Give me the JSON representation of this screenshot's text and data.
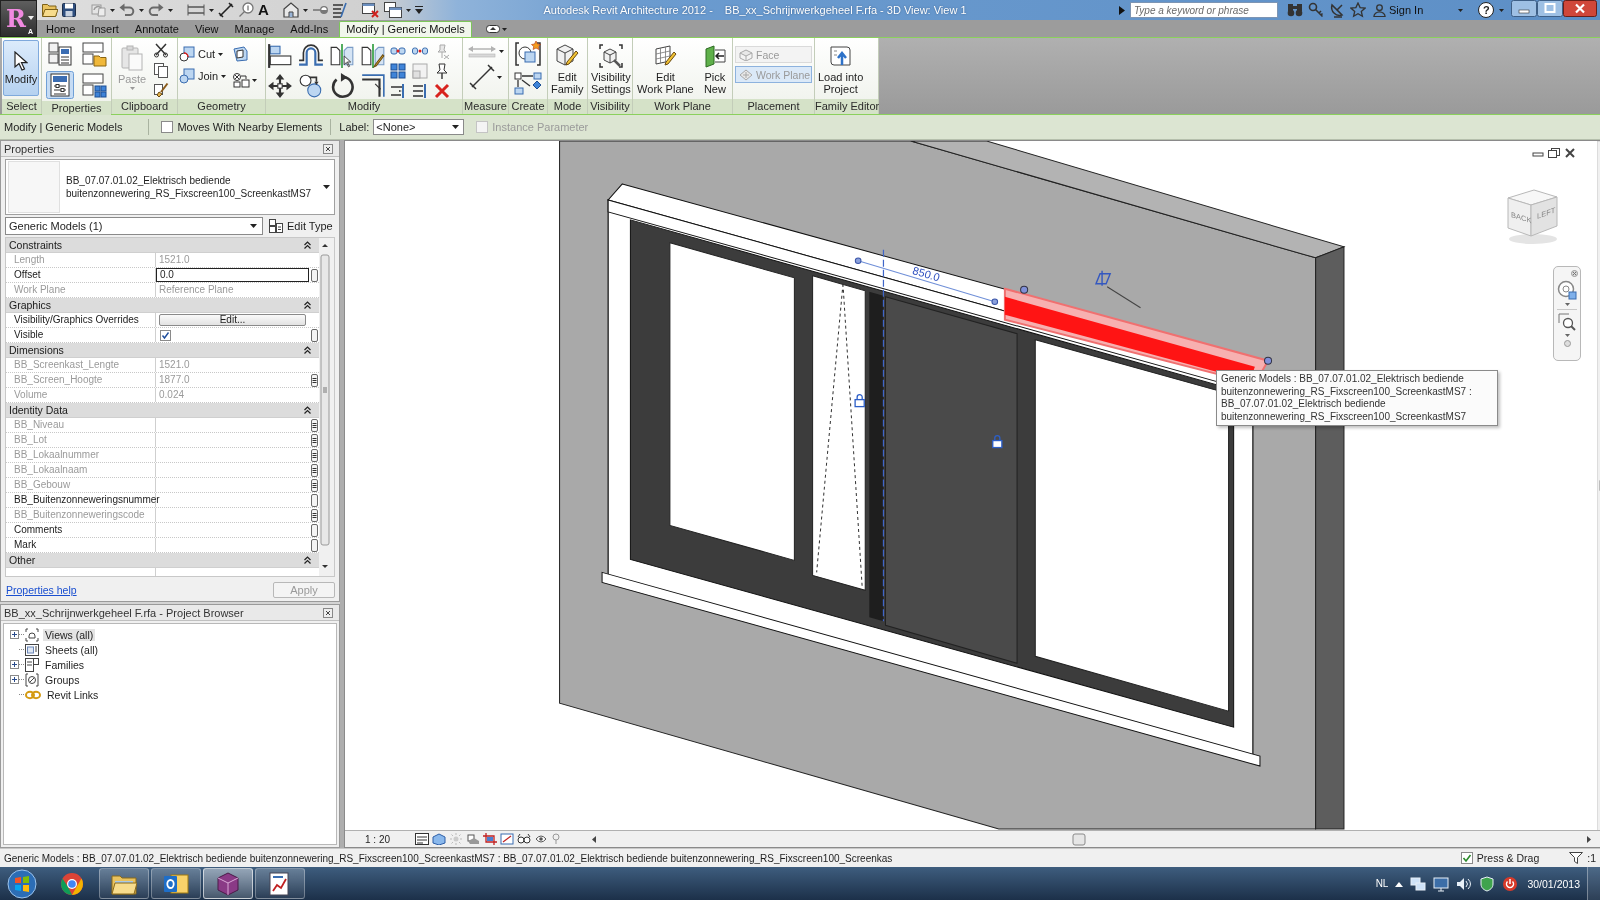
{
  "app_button": {
    "logo": "R",
    "edition": "A"
  },
  "quick_access": {
    "text_tool": "A"
  },
  "title_bar": {
    "app_title": "Autodesk Revit Architecture 2012 -",
    "document_title": "BB_xx_Schrijnwerkgeheel F.rfa - 3D View: View 1",
    "search": {
      "placeholder": "Type a keyword or phrase"
    },
    "sign_in": "Sign In",
    "help": "?"
  },
  "ribbon": {
    "tabs": [
      {
        "label": "Home",
        "selected": false
      },
      {
        "label": "Insert",
        "selected": false
      },
      {
        "label": "Annotate",
        "selected": false
      },
      {
        "label": "View",
        "selected": false
      },
      {
        "label": "Manage",
        "selected": false
      },
      {
        "label": "Add-Ins",
        "selected": false
      },
      {
        "label": "Modify | Generic Models",
        "selected": true
      }
    ],
    "panels": [
      {
        "label": "Select",
        "buttons": [
          {
            "label": "Modify",
            "selected": true,
            "disabled": false
          }
        ]
      },
      {
        "label": "Properties",
        "toggles": [
          {
            "selected": false
          },
          {
            "selected": false
          },
          {
            "selected": true
          },
          {
            "selected": false
          }
        ]
      },
      {
        "label": "Clipboard",
        "buttons": [
          {
            "label": "Paste",
            "disabled": true
          }
        ]
      },
      {
        "label": "Geometry",
        "buttons": [
          {
            "label": "Cut",
            "disabled": false
          },
          {
            "label": "Join",
            "disabled": false
          }
        ]
      },
      {
        "label": "Modify"
      },
      {
        "label": "Measure"
      },
      {
        "label": "Create"
      },
      {
        "label": "Mode",
        "buttons": [
          {
            "label": "Edit\nFamily",
            "disabled": false
          }
        ]
      },
      {
        "label": "Visibility",
        "buttons": [
          {
            "label": "Visibility\nSettings",
            "disabled": false
          }
        ]
      },
      {
        "label": "Work Plane",
        "buttons": [
          {
            "label": "Edit\nWork Plane",
            "disabled": false
          },
          {
            "label": "Pick\nNew",
            "disabled": false
          }
        ]
      },
      {
        "label": "Placement",
        "buttons": [
          {
            "label": "Face",
            "disabled": true,
            "selected": false
          },
          {
            "label": "Work Plane",
            "disabled": true,
            "selected": true
          }
        ]
      },
      {
        "label": "Family Editor",
        "buttons": [
          {
            "label": "Load into\nProject",
            "disabled": false
          }
        ]
      }
    ]
  },
  "options_bar": {
    "context": "Modify | Generic Models",
    "moves_with_nearby": {
      "label": "Moves With Nearby Elements",
      "checked": false
    },
    "label_field": {
      "label": "Label:",
      "value": "<None>"
    },
    "instance_parameter": {
      "label": "Instance Parameter",
      "checked": false,
      "disabled": true
    }
  },
  "properties": {
    "title": "Properties",
    "type_name": "BB_07.07.01.02_Elektrisch bediende buitenzonnewering_RS_Fixscreen100_ScreenkastMS7",
    "selector": "Generic Models (1)",
    "edit_type": "Edit Type",
    "groups": [
      {
        "name": "Constraints",
        "expanded": true,
        "rows": [
          {
            "name": "Length",
            "kind": "text",
            "value": "1521.0",
            "disabled": true
          },
          {
            "name": "Offset",
            "kind": "input",
            "value": "0.0",
            "disabled": false,
            "associated": false
          },
          {
            "name": "Work Plane",
            "kind": "text",
            "value": "Reference Plane",
            "disabled": true
          }
        ]
      },
      {
        "name": "Graphics",
        "expanded": true,
        "rows": [
          {
            "name": "Visibility/Graphics Overrides",
            "kind": "button",
            "value": "Edit...",
            "disabled": false
          },
          {
            "name": "Visible",
            "kind": "checkbox",
            "checked": true,
            "disabled": false,
            "associated": false
          }
        ]
      },
      {
        "name": "Dimensions",
        "expanded": true,
        "rows": [
          {
            "name": "BB_Screenkast_Lengte",
            "kind": "text",
            "value": "1521.0",
            "disabled": true
          },
          {
            "name": "BB_Screen_Hoogte",
            "kind": "text",
            "value": "1877.0",
            "disabled": true,
            "associated": true
          },
          {
            "name": "Volume",
            "kind": "text",
            "value": "0.024",
            "disabled": true
          }
        ]
      },
      {
        "name": "Identity Data",
        "expanded": true,
        "rows": [
          {
            "name": "BB_Niveau",
            "kind": "text",
            "disabled": true,
            "associated": true
          },
          {
            "name": "BB_Lot",
            "kind": "text",
            "disabled": true,
            "associated": true
          },
          {
            "name": "BB_Lokaalnummer",
            "kind": "text",
            "disabled": true,
            "associated": true
          },
          {
            "name": "BB_Lokaalnaam",
            "kind": "text",
            "disabled": true,
            "associated": true
          },
          {
            "name": "BB_Gebouw",
            "kind": "text",
            "disabled": true,
            "associated": true
          },
          {
            "name": "BB_Buitenzonneweringsnummer",
            "kind": "text",
            "disabled": false,
            "associated": false
          },
          {
            "name": "BB_Buitenzonneweringscode",
            "kind": "text",
            "disabled": true,
            "associated": true
          },
          {
            "name": "Comments",
            "kind": "text",
            "disabled": false,
            "associated": false
          },
          {
            "name": "Mark",
            "kind": "text",
            "disabled": false,
            "associated": false
          }
        ]
      },
      {
        "name": "Other",
        "expanded": true
      }
    ],
    "help_link": "Properties help",
    "apply": {
      "label": "Apply",
      "disabled": true
    }
  },
  "project_browser": {
    "title": "BB_xx_Schrijnwerkgeheel F.rfa - Project Browser",
    "items": [
      {
        "label": "Views (all)",
        "expanded": false,
        "selected": true
      },
      {
        "label": "Sheets (all)",
        "selected": false
      },
      {
        "label": "Families",
        "expanded": false,
        "selected": false
      },
      {
        "label": "Groups",
        "expanded": false,
        "selected": false
      },
      {
        "label": "Revit Links",
        "selected": false
      }
    ]
  },
  "view": {
    "scale": "1 : 20",
    "dimension": "850.0",
    "tooltip": "Generic Models : BB_07.07.01.02_Elektrisch bediende buitenzonnewering_RS_Fixscreen100_ScreenkastMS7 : BB_07.07.01.02_Elektrisch bediende buitenzonnewering_RS_Fixscreen100_ScreenkastMS7",
    "view_cube": {
      "back": "BACK",
      "left": "LEFT"
    }
  },
  "status_bar": {
    "text": "Generic Models : BB_07.07.01.02_Elektrisch bediende buitenzonnewering_RS_Fixscreen100_ScreenkastMS7 : BB_07.07.01.02_Elektrisch bediende buitenzonnewering_RS_Fixscreen100_Screenkas",
    "press_drag": {
      "label": "Press & Drag",
      "checked": true
    },
    "filter": ":1"
  },
  "taskbar": {
    "apps": [
      {
        "running": false,
        "selected": false
      },
      {
        "running": true,
        "selected": false
      },
      {
        "running": true,
        "selected": false
      },
      {
        "running": true,
        "selected": true
      },
      {
        "running": true,
        "selected": false
      }
    ],
    "language": "NL",
    "date": "30/01/2013"
  }
}
